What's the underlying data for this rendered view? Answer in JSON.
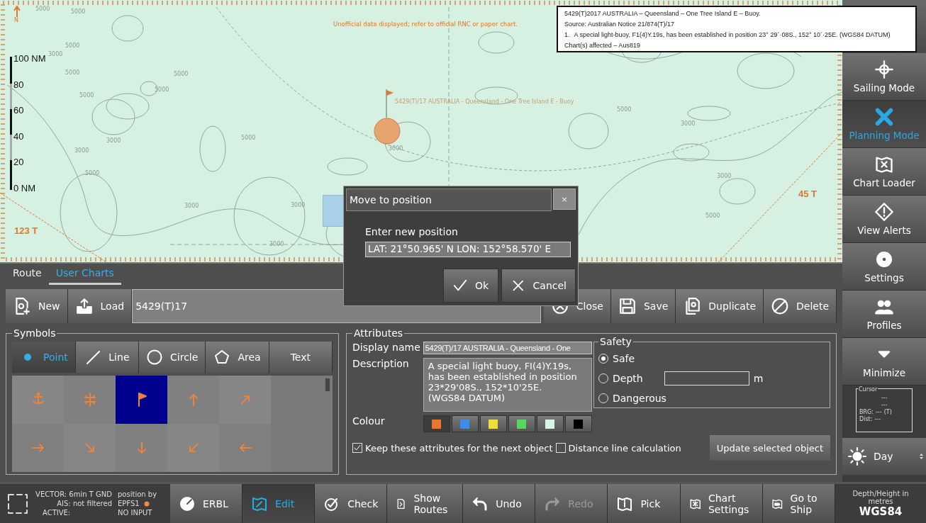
{
  "chart": {
    "north_label": "N",
    "scale_labels": [
      "100 NM",
      "80",
      "60",
      "40",
      "20",
      "0 NM"
    ],
    "disclaimer": "Unofficial data displayed; refer to official RNC or paper chart.",
    "object_label": "5429(T)/17 AUSTRALIA - Queensland - One Tree Island E - Buoy",
    "bearing_labels": [
      "123 T",
      "45 T"
    ],
    "depth_labels": [
      "5000",
      "5000",
      "5000",
      "3000",
      "5000",
      "5000",
      "5000",
      "5000",
      "3000",
      "3000",
      "5000",
      "5000",
      "3000",
      "3000",
      "3000",
      "3000",
      "5000",
      "3000",
      "3000",
      "5000"
    ]
  },
  "notice": {
    "title": "5429(T)2017 AUSTRALIA – Queensland – One Tree Island E – Buoy.",
    "source": "Source: Australian Notice 21/874(T)/17",
    "items": [
      {
        "number": "1.",
        "text": "A special light-buoy, F1(4)Y.19s, has been established in position 23° 29´·08S., 152° 10´·25E. (WGS84 DATUM)"
      }
    ],
    "charts_affected": "Chart(s) affected – Aus819"
  },
  "dialog": {
    "title": "Move to position",
    "close": "×",
    "prompt": "Enter new position",
    "value": "LAT: 21°50.965' N  LON: 152°58.570' E",
    "buttons": [
      {
        "label": "Ok",
        "kind": "ok"
      },
      {
        "label": "Cancel",
        "kind": "cancel"
      }
    ]
  },
  "tabs": [
    {
      "label": "Route",
      "selected": false
    },
    {
      "label": "User Charts",
      "selected": true
    }
  ],
  "toolbar": {
    "left_buttons": [
      "New",
      "Load"
    ],
    "chart_name": "5429(T)17",
    "right_buttons": [
      "Close",
      "Save",
      "Duplicate",
      "Delete"
    ]
  },
  "symbols": {
    "title": "Symbols",
    "tools": [
      {
        "label": "Point",
        "selected": true
      },
      {
        "label": "Line",
        "selected": false
      },
      {
        "label": "Circle",
        "selected": false
      },
      {
        "label": "Area",
        "selected": false
      },
      {
        "label": "Text",
        "selected": false
      }
    ],
    "grid": [
      {
        "kind": "anchor",
        "selected": false
      },
      {
        "kind": "wreck",
        "selected": false
      },
      {
        "kind": "flag",
        "selected": true
      },
      {
        "kind": "arrow-n",
        "selected": false
      },
      {
        "kind": "arrow-ne",
        "selected": false
      },
      {
        "kind": "arrow-e",
        "selected": false
      },
      {
        "kind": "arrow-se",
        "selected": false
      },
      {
        "kind": "arrow-s",
        "selected": false
      },
      {
        "kind": "arrow-sw",
        "selected": false
      },
      {
        "kind": "arrow-w",
        "selected": false
      }
    ]
  },
  "attributes": {
    "title": "Attributes",
    "display_name_label": "Display name",
    "display_name": "5429(T)/17 AUSTRALIA - Queensland - One",
    "description_label": "Description",
    "description": "A special light buoy, FI(4)Y.19s, has been established in position 23*29'08S., 152*10'25E.\n(WGS84 DATUM)",
    "colour_label": "Colour",
    "colours": [
      {
        "color": "#e8782c",
        "selected": true
      },
      {
        "color": "#3c8ce8",
        "selected": false
      },
      {
        "color": "#f0dc3c",
        "selected": false
      },
      {
        "color": "#58d858",
        "selected": false
      },
      {
        "color": "#d8f4e4",
        "selected": false
      },
      {
        "color": "#000000",
        "selected": false
      }
    ],
    "safety": {
      "title": "Safety",
      "options": [
        {
          "label": "Safe",
          "selected": true
        },
        {
          "label": "Depth",
          "selected": false
        },
        {
          "label": "Dangerous",
          "selected": false
        }
      ],
      "unit": "m"
    },
    "checkboxes": [
      {
        "label": "Keep these attributes for the next object",
        "checked": true
      },
      {
        "label": "Distance line calculation",
        "checked": false
      }
    ],
    "update_button": "Update selected object"
  },
  "sidebar": {
    "items": [
      {
        "label": "Sailing Mode",
        "selected": false
      },
      {
        "label": "Planning Mode",
        "selected": true
      },
      {
        "label": "Chart Loader",
        "selected": false
      },
      {
        "label": "View Alerts",
        "selected": false
      },
      {
        "label": "Settings",
        "selected": false
      },
      {
        "label": "Profiles",
        "selected": false
      },
      {
        "label": "Minimize",
        "selected": false
      }
    ],
    "cursor": {
      "title": "Cursor",
      "lines": [
        "---",
        "---"
      ],
      "brg_label": "BRG:",
      "brg": "---",
      "brg_unit": "(T)",
      "dist_label": "Dist:",
      "dist": "---"
    },
    "day": "Day"
  },
  "status": {
    "vector": "VECTOR: 6min T GND",
    "ais": "AIS: not filtered",
    "active": "ACTIVE:",
    "position_by": "position by",
    "sensor": "EPFS1",
    "input": "NO INPUT"
  },
  "bottom_buttons": [
    {
      "label": "ERBL",
      "selected": false,
      "disabled": false
    },
    {
      "label": "Edit",
      "selected": true,
      "disabled": false
    },
    {
      "label": "Check",
      "selected": false,
      "disabled": false
    },
    {
      "label": "Show Routes",
      "selected": false,
      "disabled": false
    },
    {
      "label": "Undo",
      "selected": false,
      "disabled": false
    },
    {
      "label": "Redo",
      "selected": false,
      "disabled": true
    },
    {
      "label": "Pick",
      "selected": false,
      "disabled": false
    },
    {
      "label": "Chart Settings",
      "selected": false,
      "disabled": false
    },
    {
      "label": "Go to Ship",
      "selected": false,
      "disabled": false
    }
  ],
  "datum": {
    "caption": "Depth/Height in metres",
    "value": "WGS84"
  }
}
